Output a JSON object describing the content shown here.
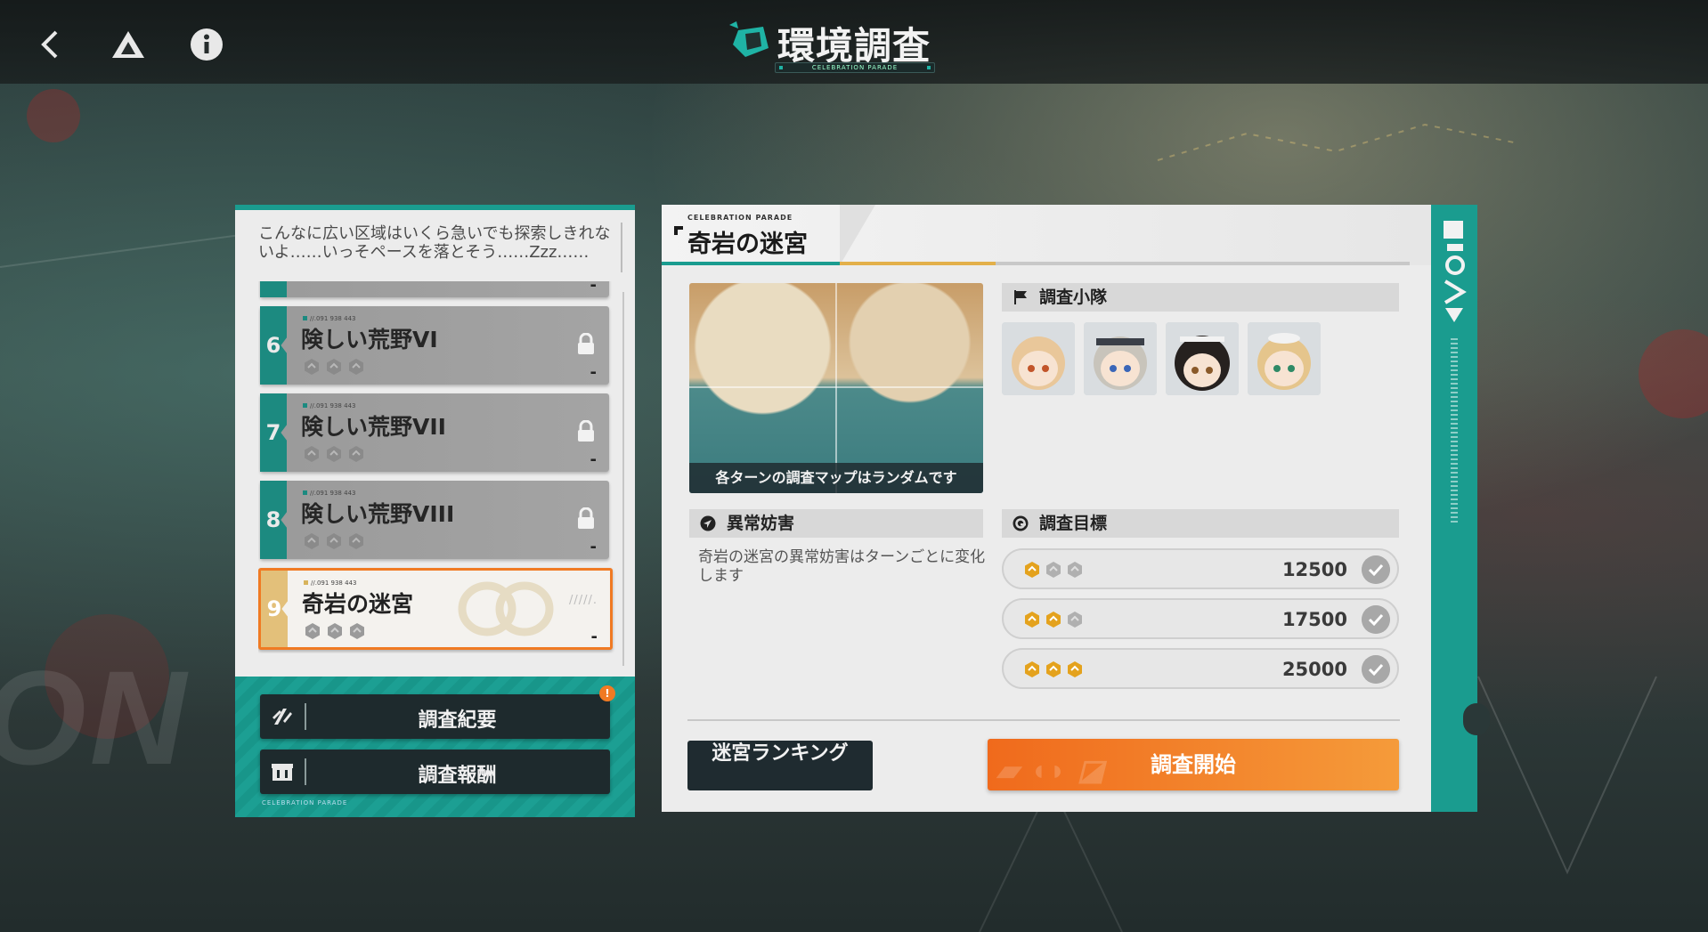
{
  "header": {
    "title": "環境調査",
    "subtitle": "CELEBRATION PARADE",
    "back_icon": "chevron-left-icon",
    "home_icon": "triangle-logo-icon",
    "info_icon": "info-icon"
  },
  "background": {
    "word": "ON"
  },
  "left_panel": {
    "quote": "こんなに広い区域はいくら急いでも探索しきれないよ……いっそペースを落とそう……Zzz……",
    "stages": [
      {
        "number": "6",
        "code": "//.091 938 443",
        "name": "険しい荒野VI",
        "locked": true,
        "score": "-",
        "stars": 0
      },
      {
        "number": "7",
        "code": "//.091 938 443",
        "name": "険しい荒野VII",
        "locked": true,
        "score": "-",
        "stars": 0
      },
      {
        "number": "8",
        "code": "//.091 938 443",
        "name": "険しい荒野VIII",
        "locked": true,
        "score": "-",
        "stars": 0
      },
      {
        "number": "9",
        "code": "//.091 938 443",
        "name": "奇岩の迷宮",
        "locked": false,
        "score": "-",
        "stars": 0,
        "selected": true
      }
    ],
    "buttons": {
      "summary": "調査紀要",
      "summary_badge": "!",
      "reward": "調査報酬"
    },
    "footer": "CELEBRATION PARADE"
  },
  "detail": {
    "small_label": "CELEBRATION PARADE",
    "title": "奇岩の迷宮",
    "map_caption": "各ターンの調査マップはランダムです",
    "team_header": "調査小隊",
    "anomaly_header": "異常妨害",
    "anomaly_desc": "奇岩の迷宮の異常妨害はターンごとに変化します",
    "goal_header": "調査目標",
    "goals": [
      {
        "score": "12500",
        "stars": 1
      },
      {
        "score": "17500",
        "stars": 2
      },
      {
        "score": "25000",
        "stars": 3
      }
    ],
    "ranking_button": "迷宮ランキング",
    "start_button": "調査開始"
  },
  "colors": {
    "teal": "#1a9c8f",
    "orange": "#f07a23",
    "gold": "#e4a21d",
    "dark": "#1f2b30"
  }
}
